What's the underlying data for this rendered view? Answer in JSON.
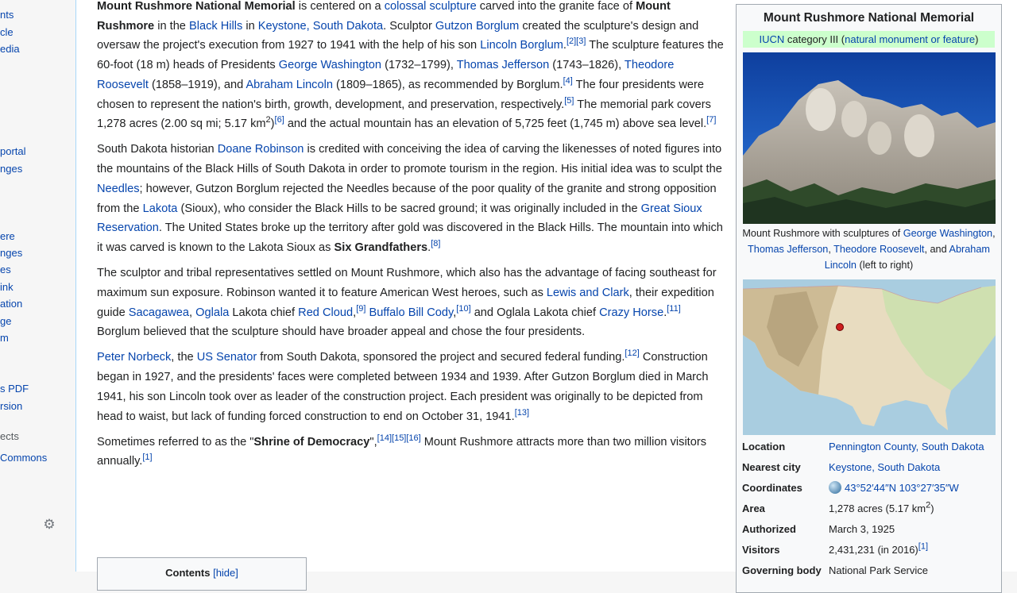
{
  "sidebar": {
    "items": [
      "nts",
      "cle",
      "edia",
      "portal",
      "nges",
      "ere",
      "nges",
      "es",
      "ink",
      "ation",
      "ge",
      "m",
      "s PDF",
      "rsion",
      "ects",
      "Commons"
    ]
  },
  "article": {
    "p1": {
      "b1": "Mount Rushmore National Memorial",
      "t1": " is centered on a ",
      "a1": "colossal sculpture",
      "t2": " carved into the granite face of ",
      "b2": "Mount Rushmore",
      "t3": " in the ",
      "a2": "Black Hills",
      "t4": " in ",
      "a3": "Keystone, South Dakota",
      "t5": ". Sculptor ",
      "a4": "Gutzon Borglum",
      "t6": " created the sculpture's design and oversaw the project's execution from 1927 to 1941 with the help of his son ",
      "a5": "Lincoln Borglum",
      "t7": ".",
      "s1": "[2][3]",
      "t8": " The sculpture features the 60-foot (18 m) heads of Presidents ",
      "a6": "George Washington",
      "t9": " (1732–1799), ",
      "a7": "Thomas Jefferson",
      "t10": " (1743–1826), ",
      "a8": "Theodore Roosevelt",
      "t11": " (1858–1919), and ",
      "a9": "Abraham Lincoln",
      "t12": " (1809–1865), as recommended by Borglum.",
      "s2": "[4]",
      "t13": " The four presidents were chosen to represent the nation's birth, growth, development, and preservation, respectively.",
      "s3": "[5]",
      "t14": " The memorial park covers 1,278 acres (2.00 sq mi; 5.17 km",
      "s4": "2",
      "t15": ")",
      "s5": "[6]",
      "t16": " and the actual mountain has an elevation of 5,725 feet (1,745 m) above sea level.",
      "s6": "[7]"
    },
    "p2": {
      "t1": "South Dakota historian ",
      "a1": "Doane Robinson",
      "t2": " is credited with conceiving the idea of carving the likenesses of noted figures into the mountains of the Black Hills of South Dakota in order to promote tourism in the region. His initial idea was to sculpt the ",
      "a2": "Needles",
      "t3": "; however, Gutzon Borglum rejected the Needles because of the poor quality of the granite and strong opposition from the ",
      "a3": "Lakota",
      "t4": " (Sioux), who consider the Black Hills to be sacred ground; it was originally included in the ",
      "a4": "Great Sioux Reservation",
      "t5": ". The United States broke up the territory after gold was discovered in the Black Hills. The mountain into which it was carved is known to the Lakota Sioux as ",
      "b1": "Six Grandfathers",
      "t6": ".",
      "s1": "[8]"
    },
    "p3": {
      "t1": "The sculptor and tribal representatives settled on Mount Rushmore, which also has the advantage of facing southeast for maximum sun exposure. Robinson wanted it to feature American West heroes, such as ",
      "a1": "Lewis and Clark",
      "t2": ", their expedition guide ",
      "a2": "Sacagawea",
      "t3": ", ",
      "a3": "Oglala",
      "t4": " Lakota chief ",
      "a4": "Red Cloud",
      "t5": ",",
      "s1": "[9]",
      "t6": " ",
      "a5": "Buffalo Bill Cody",
      "t7": ",",
      "s2": "[10]",
      "t8": " and Oglala Lakota chief ",
      "a6": "Crazy Horse",
      "t9": ".",
      "s3": "[11]",
      "t10": " Borglum believed that the sculpture should have broader appeal and chose the four presidents."
    },
    "p4": {
      "a1": "Peter Norbeck",
      "t1": ", the ",
      "a2": "US Senator",
      "t2": " from South Dakota, sponsored the project and secured federal funding.",
      "s1": "[12]",
      "t3": " Construction began in 1927, and the presidents' faces were completed between 1934 and 1939. After Gutzon Borglum died in March 1941, his son Lincoln took over as leader of the construction project. Each president was originally to be depicted from head to waist, but lack of funding forced construction to end on October 31, 1941.",
      "s2": "[13]"
    },
    "p5": {
      "t1": "Sometimes referred to as the \"",
      "b1": "Shrine of Democracy",
      "t2": "\",",
      "s1": "[14][15][16]",
      "t3": " Mount Rushmore attracts more than two million visitors annually.",
      "s2": "[1]"
    }
  },
  "toc": {
    "title": "Contents",
    "hide": "[hide]"
  },
  "infobox": {
    "title": "Mount Rushmore National Memorial",
    "iucn_link": "IUCN",
    "iucn_mid": " category III (",
    "iucn_cat": "natural monument or feature",
    "iucn_end": ")",
    "caption": {
      "t1": "Mount Rushmore with sculptures of ",
      "a1": "George Washington",
      "t2": ", ",
      "a2": "Thomas Jefferson",
      "t3": ", ",
      "a3": "Theodore Roosevelt",
      "t4": ", and ",
      "a4": "Abraham Lincoln",
      "t5": " (left to right)"
    },
    "rows": {
      "location_label": "Location",
      "location_value": "Pennington County, South Dakota",
      "city_label": "Nearest city",
      "city_value": "Keystone, South Dakota",
      "coord_label": "Coordinates",
      "coord_value": "43°52′44″N 103°27′35″W",
      "area_label": "Area",
      "area_value": "1,278 acres (5.17 km",
      "area_sup": "2",
      "area_end": ")",
      "auth_label": "Authorized",
      "auth_value": "March 3, 1925",
      "visitors_label": "Visitors",
      "visitors_value": "2,431,231 (in 2016)",
      "visitors_sup": "[1]",
      "gov_label": "Governing body",
      "gov_value": "National Park Service"
    }
  },
  "colors": {
    "link": "#0645ad",
    "iucn_bg": "#ccffcc",
    "sky": "#1f5fc7",
    "map_marker": "#cc1f1f"
  },
  "icons": {
    "settings": "gear-icon",
    "coordinates": "globe-icon"
  }
}
